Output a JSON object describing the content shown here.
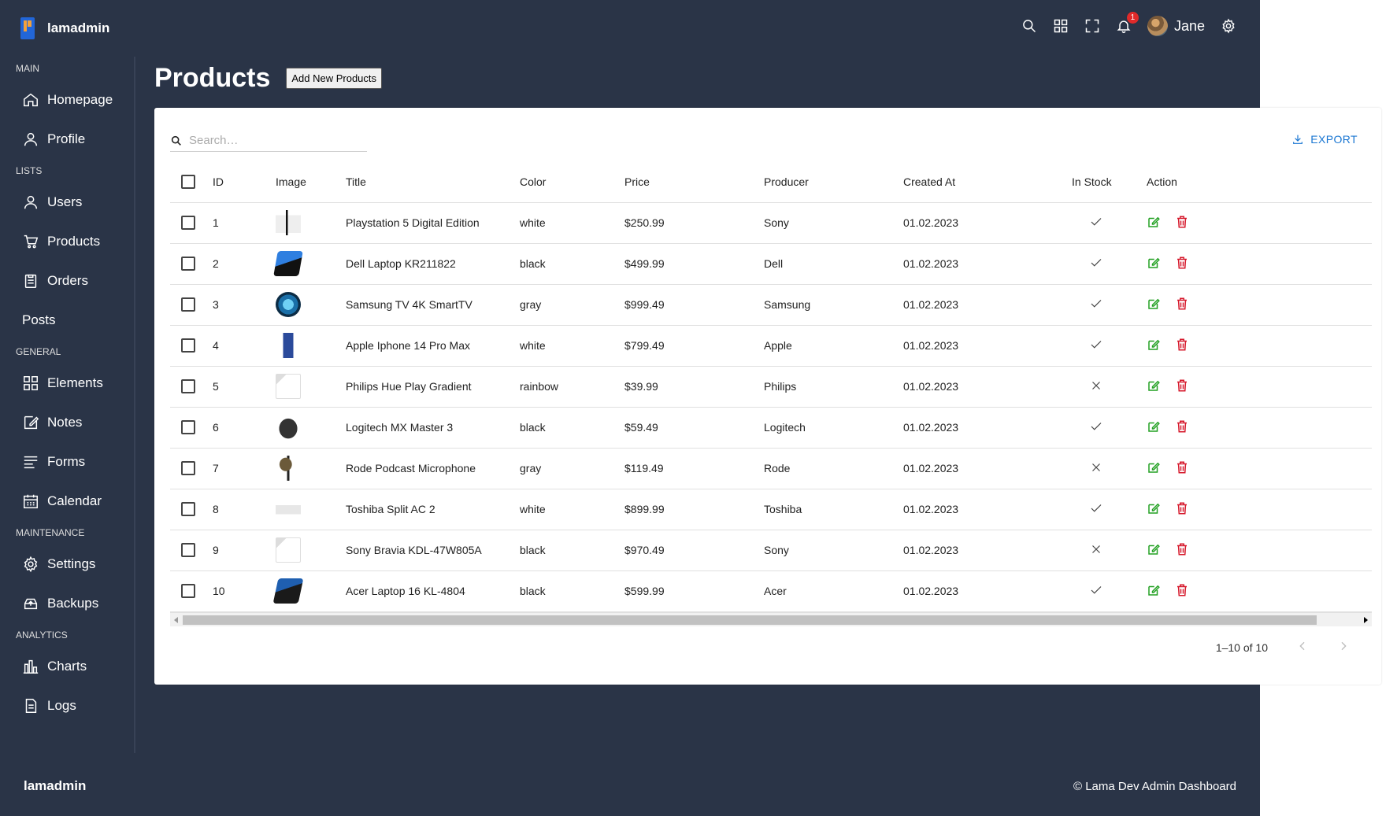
{
  "brand": {
    "name": "lamadmin"
  },
  "navbar": {
    "notifications_count": "1",
    "user_name": "Jane"
  },
  "sidebar": {
    "sections": [
      {
        "title": "MAIN",
        "items": [
          {
            "label": "Homepage",
            "icon": "home-icon"
          },
          {
            "label": "Profile",
            "icon": "user-icon"
          }
        ]
      },
      {
        "title": "LISTS",
        "items": [
          {
            "label": "Users",
            "icon": "user-icon"
          },
          {
            "label": "Products",
            "icon": "cart-icon"
          },
          {
            "label": "Orders",
            "icon": "clipboard-icon"
          },
          {
            "label": "Posts",
            "icon": ""
          }
        ]
      },
      {
        "title": "GENERAL",
        "items": [
          {
            "label": "Elements",
            "icon": "grid-icon"
          },
          {
            "label": "Notes",
            "icon": "note-icon"
          },
          {
            "label": "Forms",
            "icon": "form-icon"
          },
          {
            "label": "Calendar",
            "icon": "calendar-icon"
          }
        ]
      },
      {
        "title": "MAINTENANCE",
        "items": [
          {
            "label": "Settings",
            "icon": "gear-icon"
          },
          {
            "label": "Backups",
            "icon": "backup-icon"
          }
        ]
      },
      {
        "title": "ANALYTICS",
        "items": [
          {
            "label": "Charts",
            "icon": "chart-icon"
          },
          {
            "label": "Logs",
            "icon": "log-icon"
          }
        ]
      }
    ]
  },
  "page": {
    "title": "Products",
    "add_button": "Add New Products"
  },
  "toolbar": {
    "search_placeholder": "Search…",
    "export_label": "EXPORT"
  },
  "table": {
    "columns": [
      "ID",
      "Image",
      "Title",
      "Color",
      "Price",
      "Producer",
      "Created At",
      "In Stock",
      "Action"
    ],
    "rows": [
      {
        "id": "1",
        "image": "playstation",
        "title": "Playstation 5 Digital Edition",
        "color": "white",
        "price": "$250.99",
        "producer": "Sony",
        "created_at": "01.02.2023",
        "in_stock": true
      },
      {
        "id": "2",
        "image": "laptop",
        "title": "Dell Laptop KR211822",
        "color": "black",
        "price": "$499.99",
        "producer": "Dell",
        "created_at": "01.02.2023",
        "in_stock": true
      },
      {
        "id": "3",
        "image": "tv",
        "title": "Samsung TV 4K SmartTV",
        "color": "gray",
        "price": "$999.49",
        "producer": "Samsung",
        "created_at": "01.02.2023",
        "in_stock": true
      },
      {
        "id": "4",
        "image": "phone",
        "title": "Apple Iphone 14 Pro Max",
        "color": "white",
        "price": "$799.49",
        "producer": "Apple",
        "created_at": "01.02.2023",
        "in_stock": true
      },
      {
        "id": "5",
        "image": "broken",
        "title": "Philips Hue Play Gradient",
        "color": "rainbow",
        "price": "$39.99",
        "producer": "Philips",
        "created_at": "01.02.2023",
        "in_stock": false
      },
      {
        "id": "6",
        "image": "mouse",
        "title": "Logitech MX Master 3",
        "color": "black",
        "price": "$59.49",
        "producer": "Logitech",
        "created_at": "01.02.2023",
        "in_stock": true
      },
      {
        "id": "7",
        "image": "microphone",
        "title": "Rode Podcast Microphone",
        "color": "gray",
        "price": "$119.49",
        "producer": "Rode",
        "created_at": "01.02.2023",
        "in_stock": false
      },
      {
        "id": "8",
        "image": "ac",
        "title": "Toshiba Split AC 2",
        "color": "white",
        "price": "$899.99",
        "producer": "Toshiba",
        "created_at": "01.02.2023",
        "in_stock": true
      },
      {
        "id": "9",
        "image": "broken",
        "title": "Sony Bravia KDL-47W805A",
        "color": "black",
        "price": "$970.49",
        "producer": "Sony",
        "created_at": "01.02.2023",
        "in_stock": false
      },
      {
        "id": "10",
        "image": "laptop2",
        "title": "Acer Laptop 16 KL-4804",
        "color": "black",
        "price": "$599.99",
        "producer": "Acer",
        "created_at": "01.02.2023",
        "in_stock": true
      }
    ]
  },
  "pagination": {
    "range_label": "1–10 of 10"
  },
  "footer": {
    "brand": "lamadmin",
    "copyright": "© Lama Dev Admin Dashboard"
  },
  "colors": {
    "background": "#2a3447",
    "accent": "#1976d2",
    "edit": "#22a022",
    "delete": "#d6182b"
  }
}
